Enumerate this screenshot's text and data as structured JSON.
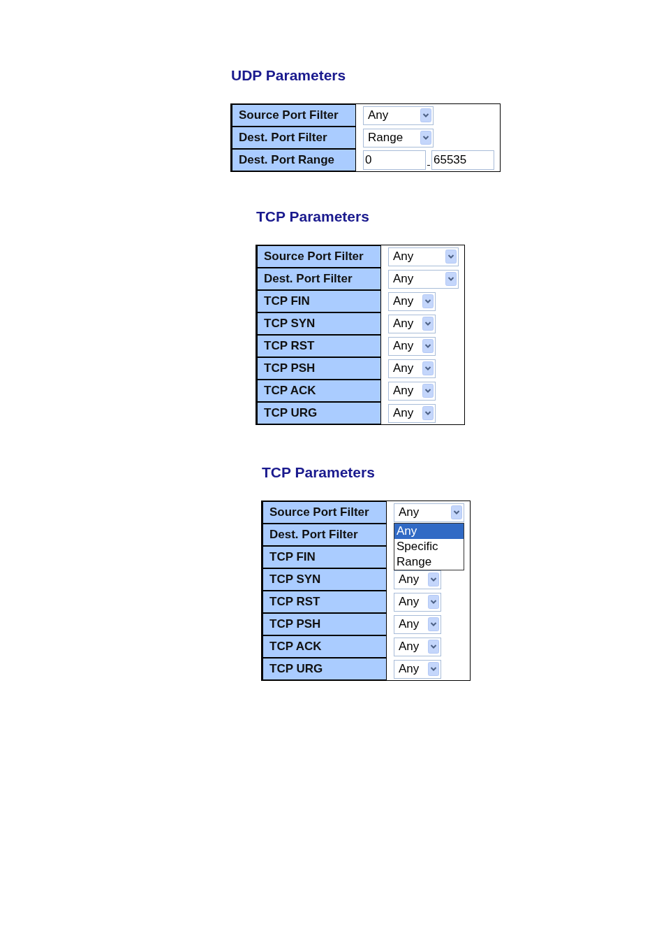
{
  "panels": [
    {
      "title": "UDP Parameters",
      "rows": [
        {
          "label": "Source Port Filter",
          "kind": "select",
          "wide": true,
          "value": "Any"
        },
        {
          "label": "Dest. Port Filter",
          "kind": "select",
          "wide": true,
          "value": "Range"
        },
        {
          "label": "Dest. Port Range",
          "kind": "range",
          "from": "0",
          "to": "65535"
        }
      ]
    },
    {
      "title": "TCP Parameters",
      "rows": [
        {
          "label": "Source Port Filter",
          "kind": "select",
          "wide": true,
          "value": "Any"
        },
        {
          "label": "Dest. Port Filter",
          "kind": "select",
          "wide": true,
          "value": "Any"
        },
        {
          "label": "TCP FIN",
          "kind": "select",
          "wide": false,
          "value": "Any"
        },
        {
          "label": "TCP SYN",
          "kind": "select",
          "wide": false,
          "value": "Any"
        },
        {
          "label": "TCP RST",
          "kind": "select",
          "wide": false,
          "value": "Any"
        },
        {
          "label": "TCP PSH",
          "kind": "select",
          "wide": false,
          "value": "Any"
        },
        {
          "label": "TCP ACK",
          "kind": "select",
          "wide": false,
          "value": "Any"
        },
        {
          "label": "TCP URG",
          "kind": "select",
          "wide": false,
          "value": "Any"
        }
      ]
    },
    {
      "title": "TCP Parameters",
      "rows": [
        {
          "label": "Source Port Filter",
          "kind": "select",
          "wide": true,
          "value": "Any",
          "options": [
            {
              "label": "Any",
              "selected": true
            },
            {
              "label": "Specific",
              "selected": false
            },
            {
              "label": "Range",
              "selected": false
            }
          ]
        },
        {
          "label": "Dest. Port Filter",
          "kind": "hidden"
        },
        {
          "label": "TCP FIN",
          "kind": "hidden"
        },
        {
          "label": "TCP SYN",
          "kind": "select",
          "wide": false,
          "value": "Any"
        },
        {
          "label": "TCP RST",
          "kind": "select",
          "wide": false,
          "value": "Any"
        },
        {
          "label": "TCP PSH",
          "kind": "select",
          "wide": false,
          "value": "Any"
        },
        {
          "label": "TCP ACK",
          "kind": "select",
          "wide": false,
          "value": "Any"
        },
        {
          "label": "TCP URG",
          "kind": "select",
          "wide": false,
          "value": "Any"
        }
      ]
    }
  ]
}
